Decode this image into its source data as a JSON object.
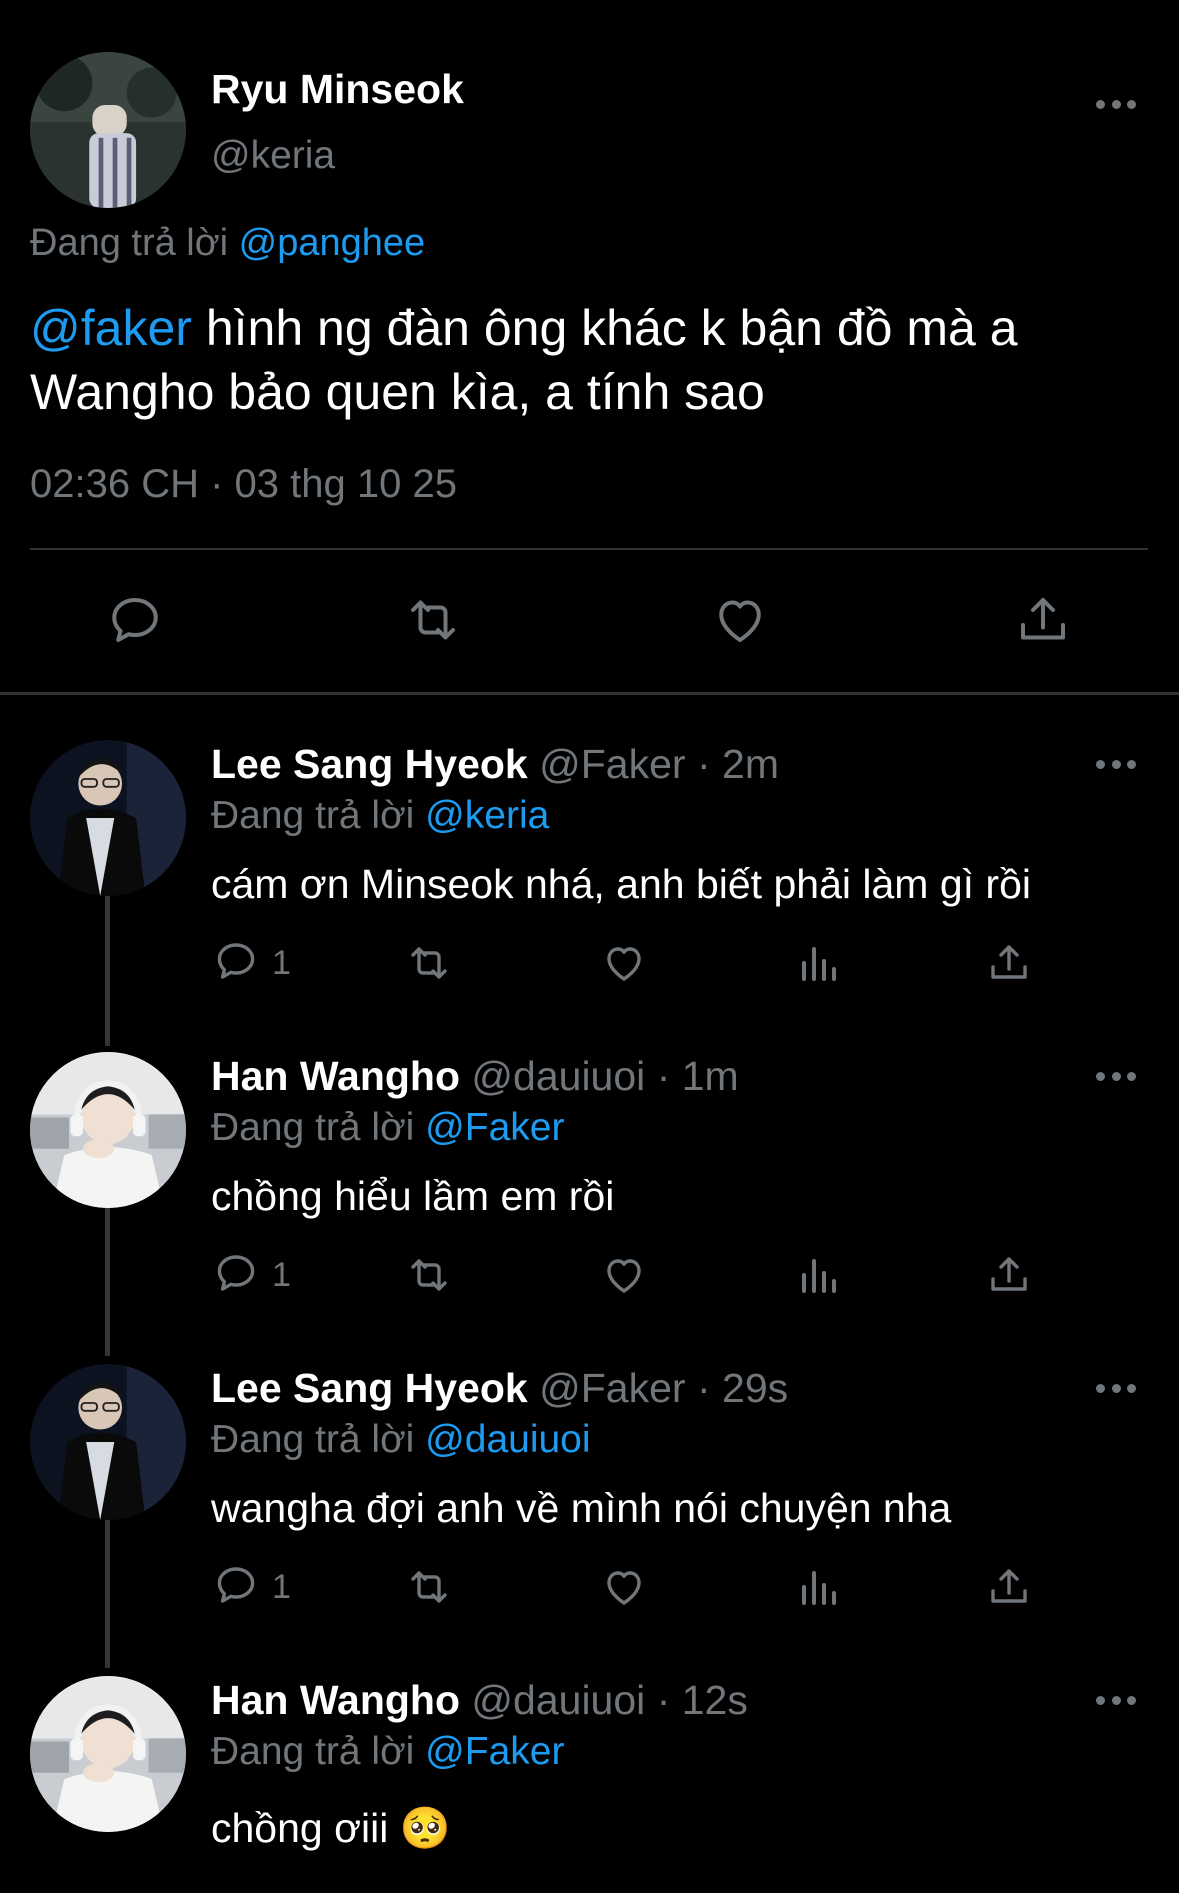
{
  "main_tweet": {
    "author_name": "Ryu Minseok",
    "author_handle": "@keria",
    "replying_prefix": "Đang trả lời ",
    "replying_to": "@panghee",
    "mention": "@faker",
    "text": " hình ng đàn ông khác k bận đồ mà a Wangho bảo quen kìa, a tính sao",
    "timestamp": "02:36 CH · 03 thg 10 25",
    "icons": [
      "reply-icon",
      "retweet-icon",
      "like-icon",
      "share-icon"
    ]
  },
  "replies": [
    {
      "name": "Lee Sang Hyeok",
      "handle": "@Faker",
      "time": "· 2m",
      "replying_prefix": "Đang trả lời ",
      "replying_to": "@keria",
      "text": "cám ơn Minseok nhá, anh biết phải làm gì rồi",
      "reply_count": "1"
    },
    {
      "name": "Han Wangho",
      "handle": "@dauiuoi",
      "time": "· 1m",
      "replying_prefix": "Đang trả lời ",
      "replying_to": "@Faker",
      "text": "chồng hiểu lầm em rồi",
      "reply_count": "1"
    },
    {
      "name": "Lee Sang Hyeok",
      "handle": "@Faker",
      "time": "· 29s",
      "replying_prefix": "Đang trả lời ",
      "replying_to": "@dauiuoi",
      "text": "wangha đợi anh về mình nói chuyện nha",
      "reply_count": "1"
    },
    {
      "name": "Han Wangho",
      "handle": "@dauiuoi",
      "time": "· 12s",
      "replying_prefix": "Đang trả lời ",
      "replying_to": "@Faker",
      "text": "chồng ơiii 🥺",
      "reply_count": ""
    }
  ],
  "colors": {
    "background": "#000000",
    "primary_text": "#ffffff",
    "secondary_text": "#71767b",
    "accent": "#1d9bf0",
    "divider": "#2f3336"
  }
}
